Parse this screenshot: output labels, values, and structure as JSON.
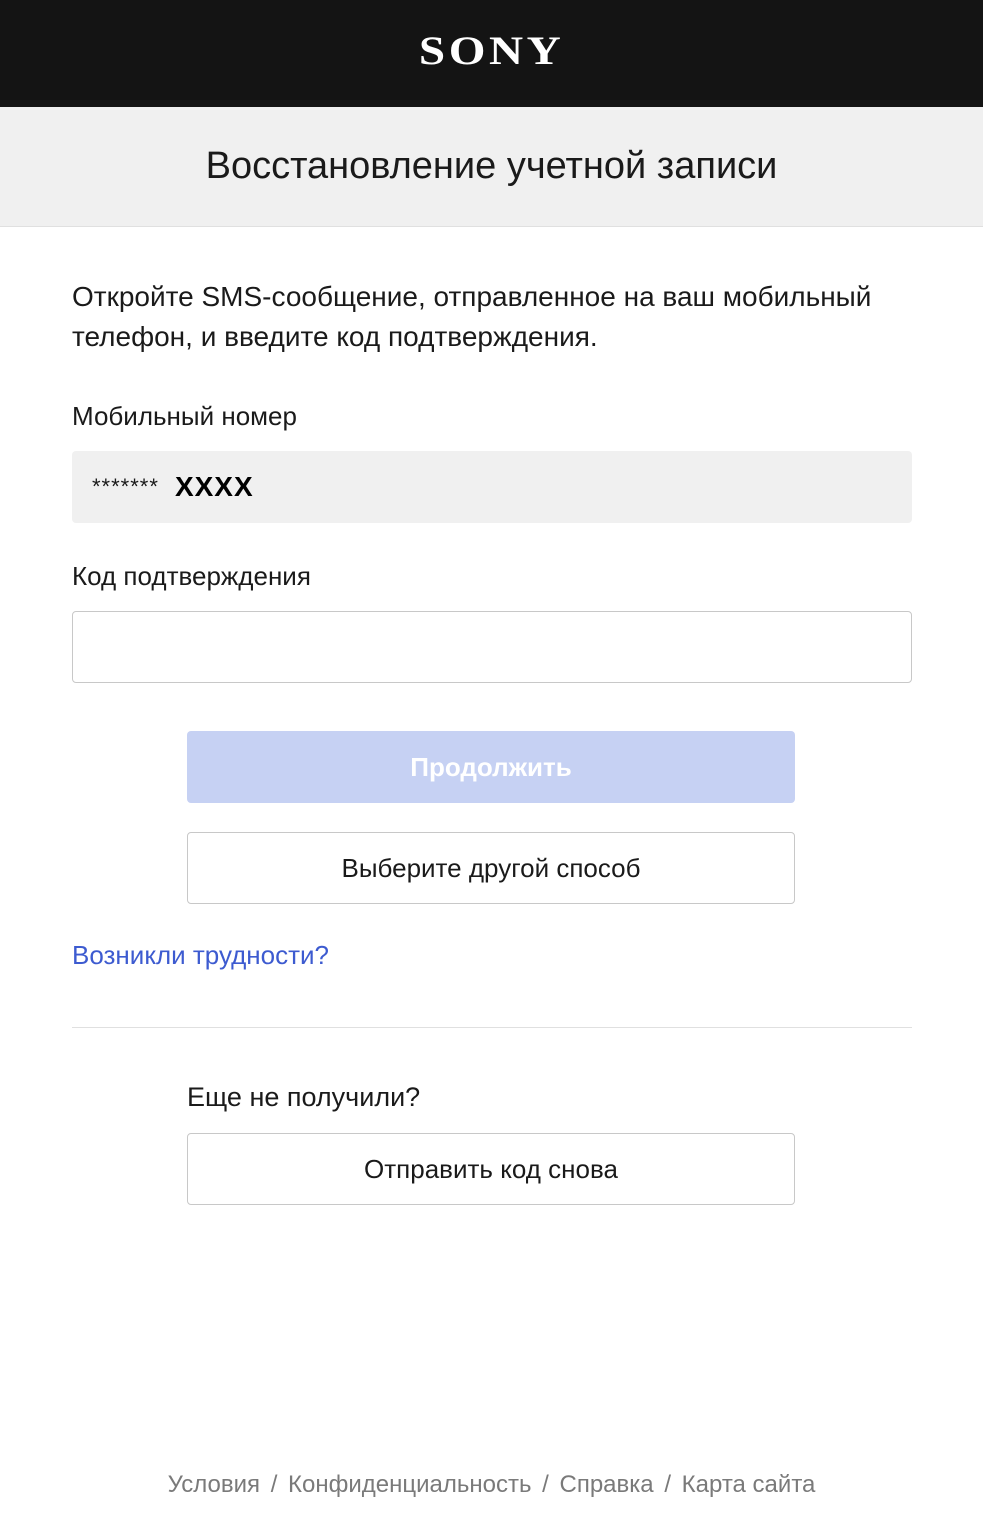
{
  "header": {
    "logo_text": "SONY",
    "title": "Восстановление учетной записи"
  },
  "instructions": "Откройте SMS-сообщение, отправленное на ваш мобильный телефон, и введите код подтверждения.",
  "mobile": {
    "label": "Мобильный номер",
    "masked_prefix": "*******",
    "suffix": "XXXX"
  },
  "code": {
    "label": "Код подтверждения",
    "value": "",
    "placeholder": ""
  },
  "buttons": {
    "continue_label": "Продолжить",
    "other_method_label": "Выберите другой способ",
    "resend_label": "Отправить код снова"
  },
  "help_link": "Возникли трудности?",
  "not_received": "Еще не получили?",
  "footer": {
    "terms": "Условия",
    "privacy": "Конфиденциальность",
    "help": "Справка",
    "sitemap": "Карта сайта",
    "separator": "/"
  },
  "colors": {
    "topbar": "#141414",
    "titlebar": "#f0f0f0",
    "primary_disabled": "#c6d1f3",
    "link": "#3d5bd0",
    "footer_text": "#7a7a7a"
  }
}
